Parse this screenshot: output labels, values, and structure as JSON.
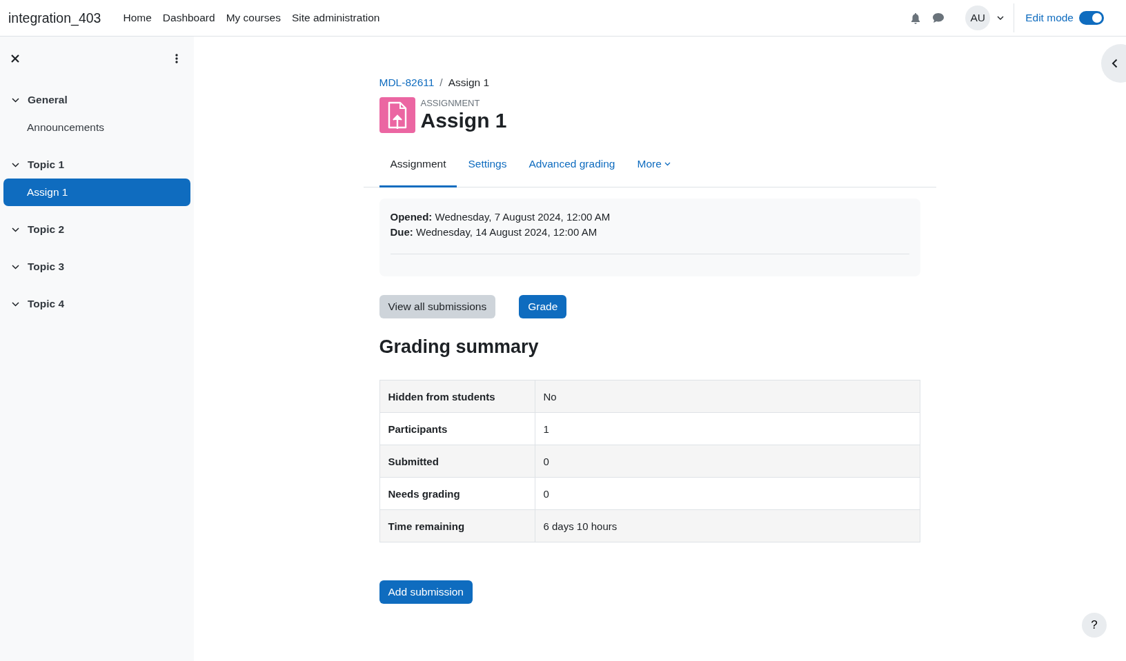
{
  "navbar": {
    "site_name": "integration_403",
    "links": [
      {
        "label": "Home"
      },
      {
        "label": "Dashboard"
      },
      {
        "label": "My courses"
      },
      {
        "label": "Site administration"
      }
    ],
    "user_initials": "AU",
    "edit_mode": {
      "label": "Edit mode",
      "on": true
    }
  },
  "sidebar": {
    "sections": [
      {
        "title": "General",
        "expanded": true,
        "items": [
          {
            "label": "Announcements",
            "selected": false
          }
        ]
      },
      {
        "title": "Topic 1",
        "expanded": true,
        "items": [
          {
            "label": "Assign 1",
            "selected": true
          }
        ]
      },
      {
        "title": "Topic 2",
        "expanded": true
      },
      {
        "title": "Topic 3",
        "expanded": true
      },
      {
        "title": "Topic 4",
        "expanded": true
      }
    ]
  },
  "breadcrumb": [
    {
      "label": "MDL-82611",
      "link": true
    },
    {
      "label": "Assign 1",
      "link": false
    }
  ],
  "breadcrumb_separator": "/",
  "header": {
    "kind_label": "ASSIGNMENT",
    "title": "Assign 1"
  },
  "tabs": [
    {
      "label": "Assignment",
      "selected": true
    },
    {
      "label": "Settings",
      "selected": false
    },
    {
      "label": "Advanced grading",
      "selected": false
    },
    {
      "label": "More",
      "selected": false
    }
  ],
  "dates": [
    "**Opened:** Wednesday, 7 August 2024, 12:00 AM",
    "**Due:** Wednesday, 14 August 2024, 12:00 AM"
  ],
  "actions": [
    {
      "label": "View all submissions",
      "kind": "secondary"
    },
    {
      "label": "Grade",
      "kind": "primary"
    }
  ],
  "grading_summary": {
    "title": "Grading summary",
    "rows": [
      {
        "label": "Hidden from students",
        "value": "No"
      },
      {
        "label": "Participants",
        "value": "1"
      },
      {
        "label": "Submitted",
        "value": "0"
      },
      {
        "label": "Needs grading",
        "value": "0"
      },
      {
        "label": "Time remaining",
        "value": "6 days 10 hours"
      }
    ]
  },
  "add_submission": "Add submission",
  "help": "?"
}
